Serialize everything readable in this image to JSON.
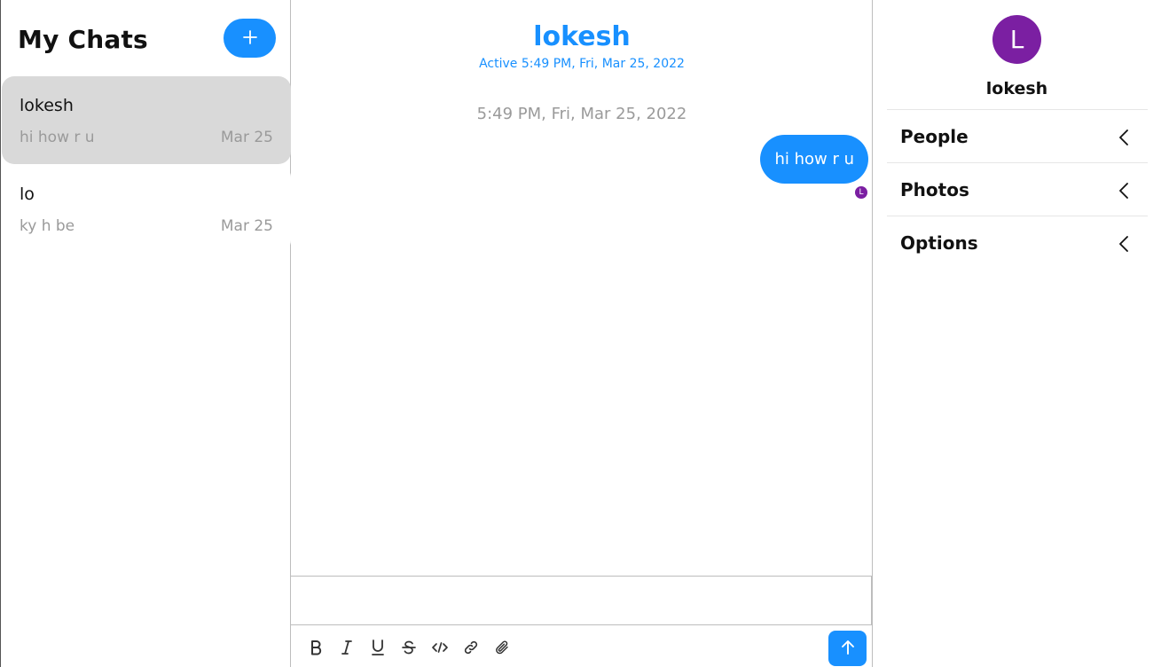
{
  "chat_list": {
    "title": "My Chats",
    "new_chat_icon": "plus-icon",
    "chats": [
      {
        "name": "lokesh",
        "preview": "hi how r u",
        "date": "Mar 25",
        "active": true
      },
      {
        "name": "lo",
        "preview": "ky h be",
        "date": "Mar 25",
        "active": false
      }
    ]
  },
  "feed": {
    "title": "lokesh",
    "subtitle": "Active 5:49 PM, Fri, Mar 25, 2022",
    "timestamp": "5:49 PM, Fri, Mar 25, 2022",
    "messages": [
      {
        "text": "hi how r u",
        "own": true,
        "read_by_initial": "L"
      }
    ],
    "composer": {
      "value": "",
      "placeholder": "",
      "tools": [
        "bold-icon",
        "italic-icon",
        "underline-icon",
        "strikethrough-icon",
        "code-icon",
        "link-icon",
        "attachment-icon"
      ],
      "send_icon": "arrow-up-icon"
    }
  },
  "settings": {
    "avatar_initial": "L",
    "name": "lokesh",
    "sections": [
      {
        "label": "People"
      },
      {
        "label": "Photos"
      },
      {
        "label": "Options"
      }
    ]
  },
  "colors": {
    "accent": "#1890ff",
    "avatar": "#7b1fa2",
    "active_chat": "#d9d9d9",
    "muted_text": "#9a9a9a"
  }
}
